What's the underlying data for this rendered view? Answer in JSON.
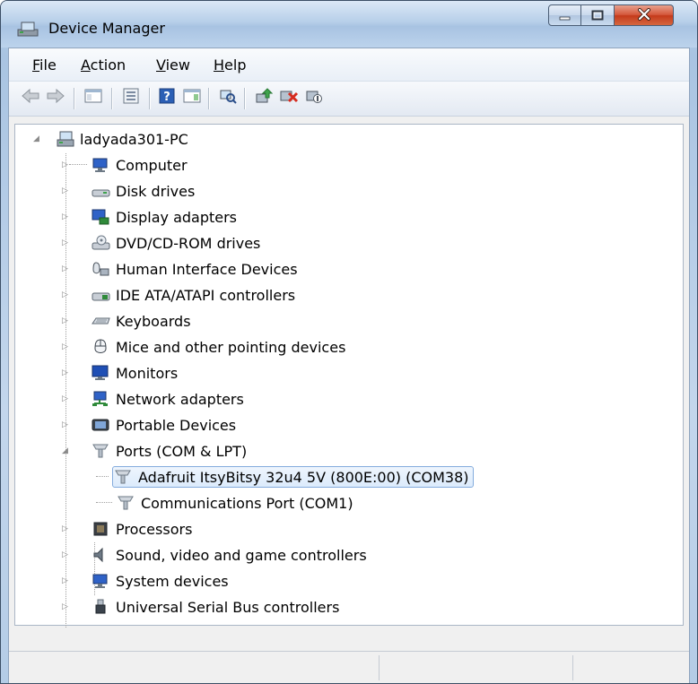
{
  "window": {
    "title": "Device Manager",
    "icons": {
      "app": "device-manager-icon",
      "minimize": "minimize-icon",
      "maximize": "maximize-icon",
      "close": "close-icon"
    }
  },
  "menubar": {
    "items": [
      {
        "label_u": "F",
        "label_rest": "ile"
      },
      {
        "label_u": "A",
        "label_rest": "ction"
      },
      {
        "label_u": "V",
        "label_rest": "iew"
      },
      {
        "label_u": "H",
        "label_rest": "elp"
      }
    ]
  },
  "toolbar": {
    "buttons": [
      "back-icon",
      "forward-icon",
      "show-hide-console-tree-icon",
      "properties-icon",
      "help-icon",
      "show-hide-action-pane-icon",
      "scan-hardware-icon",
      "update-driver-icon",
      "uninstall-icon",
      "disable-icon"
    ]
  },
  "tree": {
    "root": {
      "label": "ladyada301-PC",
      "expanded": true
    },
    "categories": [
      {
        "label": "Computer",
        "expanded": false,
        "icon": "computer-icon"
      },
      {
        "label": "Disk drives",
        "expanded": false,
        "icon": "disk-drive-icon"
      },
      {
        "label": "Display adapters",
        "expanded": false,
        "icon": "display-adapter-icon"
      },
      {
        "label": "DVD/CD-ROM drives",
        "expanded": false,
        "icon": "dvd-drive-icon"
      },
      {
        "label": "Human Interface Devices",
        "expanded": false,
        "icon": "hid-icon"
      },
      {
        "label": "IDE ATA/ATAPI controllers",
        "expanded": false,
        "icon": "ide-controller-icon"
      },
      {
        "label": "Keyboards",
        "expanded": false,
        "icon": "keyboard-icon"
      },
      {
        "label": "Mice and other pointing devices",
        "expanded": false,
        "icon": "mouse-icon"
      },
      {
        "label": "Monitors",
        "expanded": false,
        "icon": "monitor-icon"
      },
      {
        "label": "Network adapters",
        "expanded": false,
        "icon": "network-adapter-icon"
      },
      {
        "label": "Portable Devices",
        "expanded": false,
        "icon": "portable-device-icon"
      },
      {
        "label": "Ports (COM & LPT)",
        "expanded": true,
        "icon": "port-icon",
        "children": [
          {
            "label": "Adafruit ItsyBitsy 32u4 5V (800E:00) (COM38)",
            "selected": true,
            "icon": "port-icon"
          },
          {
            "label": "Communications Port (COM1)",
            "selected": false,
            "icon": "port-icon"
          }
        ]
      },
      {
        "label": "Processors",
        "expanded": false,
        "icon": "processor-icon"
      },
      {
        "label": "Sound, video and game controllers",
        "expanded": false,
        "icon": "sound-icon"
      },
      {
        "label": "System devices",
        "expanded": false,
        "icon": "system-device-icon"
      },
      {
        "label": "Universal Serial Bus controllers",
        "expanded": false,
        "icon": "usb-icon"
      }
    ]
  },
  "colors": {
    "selection_border": "#84acdd",
    "selection_fill": "#dcebfc",
    "close_button": "#c43a1b"
  }
}
